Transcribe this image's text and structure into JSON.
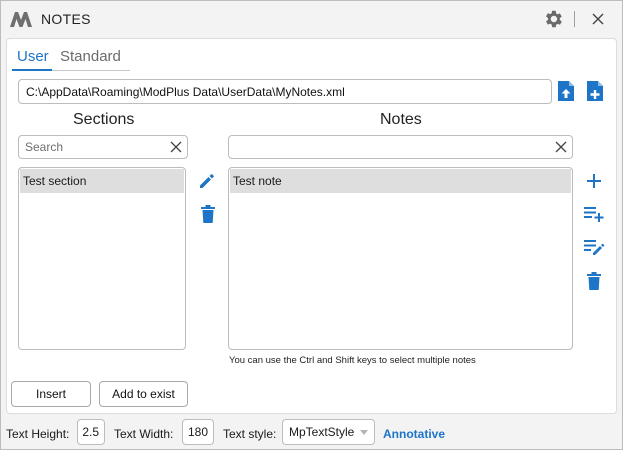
{
  "window": {
    "title": "NOTES",
    "icons": {
      "logo": "app-logo",
      "settings": "gear-icon",
      "close": "close-icon"
    }
  },
  "tabs": [
    {
      "label": "User",
      "active": true
    },
    {
      "label": "Standard",
      "active": false
    }
  ],
  "file": {
    "path": "C:\\AppData\\Roaming\\ModPlus Data\\UserData\\MyNotes.xml",
    "icons": [
      "file-upload-icon",
      "file-add-icon"
    ]
  },
  "sections": {
    "header": "Sections",
    "search_placeholder": "Search",
    "search_value": "",
    "items": [
      {
        "label": "Test section",
        "selected": true
      }
    ],
    "actions": [
      "edit-icon",
      "delete-icon"
    ]
  },
  "notes": {
    "header": "Notes",
    "search_placeholder": "",
    "search_value": "",
    "items": [
      {
        "label": "Test note",
        "selected": true
      }
    ],
    "actions": [
      "add-icon",
      "playlist-add-icon",
      "playlist-edit-icon",
      "delete-icon"
    ],
    "hint": "You can use the Ctrl and Shift keys to select multiple notes"
  },
  "buttons": {
    "insert": "Insert",
    "add_to_exist": "Add to exist"
  },
  "bottom": {
    "text_height_label": "Text Height:",
    "text_height": "2.5",
    "text_width_label": "Text Width:",
    "text_width": "180",
    "text_style_label": "Text style:",
    "text_style": "MpTextStyle",
    "annotative": "Annotative"
  },
  "colors": {
    "accent": "#1e74c6",
    "selected_row": "#dedede",
    "background": "#f3f3f3"
  }
}
